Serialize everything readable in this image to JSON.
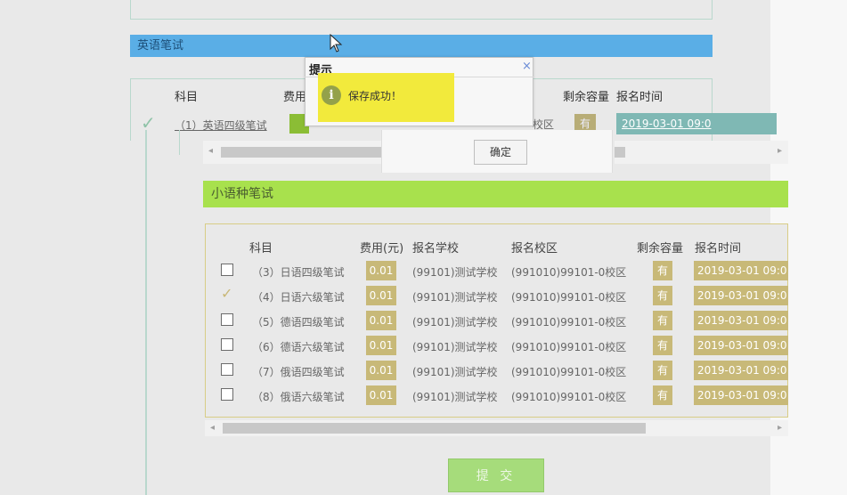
{
  "english_section": {
    "title": "英语笔试",
    "headers": {
      "subject": "科目",
      "fee": "费用",
      "remain": "剩余容量",
      "time": "报名时间"
    },
    "row": {
      "subject": "（1）英语四级笔试",
      "campus": "校区",
      "remain": "有",
      "time": "2019-03-01 09:0"
    }
  },
  "small_language_section": {
    "title": "小语种笔试",
    "headers": {
      "subject": "科目",
      "fee": "费用(元)",
      "school": "报名学校",
      "campus": "报名校区",
      "remain": "剩余容量",
      "time": "报名时间"
    },
    "rows": [
      {
        "checked": false,
        "subject": "（3）日语四级笔试",
        "fee": "0.01",
        "school": "(99101)测试学校",
        "campus": "(991010)99101-0校区",
        "remain": "有",
        "time": "2019-03-01 09:0"
      },
      {
        "checked": true,
        "subject": "（4）日语六级笔试",
        "fee": "0.01",
        "school": "(99101)测试学校",
        "campus": "(991010)99101-0校区",
        "remain": "有",
        "time": "2019-03-01 09:0"
      },
      {
        "checked": false,
        "subject": "（5）德语四级笔试",
        "fee": "0.01",
        "school": "(99101)测试学校",
        "campus": "(991010)99101-0校区",
        "remain": "有",
        "time": "2019-03-01 09:0"
      },
      {
        "checked": false,
        "subject": "（6）德语六级笔试",
        "fee": "0.01",
        "school": "(99101)测试学校",
        "campus": "(991010)99101-0校区",
        "remain": "有",
        "time": "2019-03-01 09:0"
      },
      {
        "checked": false,
        "subject": "（7）俄语四级笔试",
        "fee": "0.01",
        "school": "(99101)测试学校",
        "campus": "(991010)99101-0校区",
        "remain": "有",
        "time": "2019-03-01 09:0"
      },
      {
        "checked": false,
        "subject": "（8）俄语六级笔试",
        "fee": "0.01",
        "school": "(99101)测试学校",
        "campus": "(991010)99101-0校区",
        "remain": "有",
        "time": "2019-03-01 09:0"
      }
    ]
  },
  "submit_label": "提 交",
  "dialog": {
    "title": "提示",
    "close": "×",
    "icon": "info-icon",
    "message": "保存成功！",
    "ok_label": "确定"
  },
  "colors": {
    "blue_bar": "#5aaee6",
    "green_bar": "#a8e14d",
    "badge": "#c8b978",
    "highlight": "#f2ea3c",
    "submit": "#a6dc7b"
  }
}
